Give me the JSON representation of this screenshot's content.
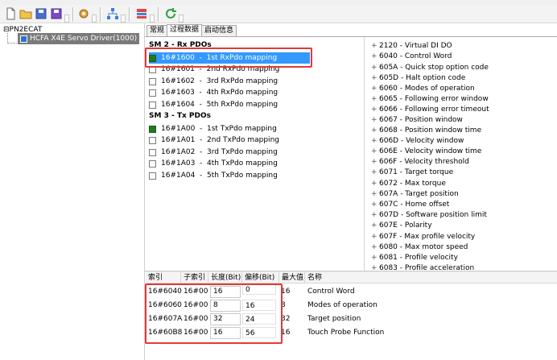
{
  "toolbar": {
    "buttons": [
      "new-file-icon",
      "open-folder-icon",
      "save-icon",
      "save-all-icon",
      "settings-icon",
      "network-icon",
      "device-config-icon",
      "refresh-icon"
    ]
  },
  "tree": {
    "root_label": "PN2ECAT",
    "device_label": "HCFA X4E Servo Driver(1000)"
  },
  "tabs": [
    {
      "label": "常规",
      "active": false
    },
    {
      "label": "过程数据",
      "active": true
    },
    {
      "label": "启动信息",
      "active": false
    }
  ],
  "sm2": {
    "title": "SM 2 - Rx PDOs",
    "items": [
      {
        "text": "16#1600  -  1st RxPdo mapping",
        "checked": true,
        "selected": true
      },
      {
        "text": "16#1601  -  2nd RxPdo mapping",
        "checked": false,
        "selected": false
      },
      {
        "text": "16#1602  -  3rd RxPdo mapping",
        "checked": false,
        "selected": false
      },
      {
        "text": "16#1603  -  4th RxPdo mapping",
        "checked": false,
        "selected": false
      },
      {
        "text": "16#1604  -  5th RxPdo mapping",
        "checked": false,
        "selected": false
      }
    ]
  },
  "sm3": {
    "title": "SM 3 - Tx PDOs",
    "items": [
      {
        "text": "16#1A00  -  1st TxPdo mapping",
        "checked": true
      },
      {
        "text": "16#1A01  -  2nd TxPdo mapping",
        "checked": false
      },
      {
        "text": "16#1A02  -  3rd TxPdo mapping",
        "checked": false
      },
      {
        "text": "16#1A03  -  4th TxPdo mapping",
        "checked": false
      },
      {
        "text": "16#1A04  -  5th TxPdo mapping",
        "checked": false
      }
    ]
  },
  "objects": [
    "2120 - Virtual DI DO",
    "6040 - Control Word",
    "605A - Quick stop option code",
    "605D - Halt option code",
    "6060 - Modes of operation",
    "6065 - Following error window",
    "6066 - Following error timeout",
    "6067 - Position window",
    "6068 - Position window time",
    "606D - Velocity window",
    "606E - Velocity window time",
    "606F - Velocity threshold",
    "6071 - Target torque",
    "6072 - Max torque",
    "607A - Target position",
    "607C - Home offset",
    "607D - Software position limit",
    "607E - Polarity",
    "607F - Max profile velocity",
    "6080 - Max motor speed",
    "6081 - Profile velocity",
    "6083 - Profile acceleration"
  ],
  "grid": {
    "headers": [
      "索引",
      "子索引",
      "长度(Bit)",
      "偏移(Bit)",
      "最大值",
      "名称"
    ],
    "rows": [
      {
        "index": "16#6040",
        "sub": "16#00",
        "len": "16",
        "offset": "0",
        "max": "16",
        "name": "Control Word"
      },
      {
        "index": "16#6060",
        "sub": "16#00",
        "len": "8",
        "offset": "16",
        "max": "8",
        "name": "Modes of operation"
      },
      {
        "index": "16#607A",
        "sub": "16#00",
        "len": "32",
        "offset": "24",
        "max": "32",
        "name": "Target position"
      },
      {
        "index": "16#60B8",
        "sub": "16#00",
        "len": "16",
        "offset": "56",
        "max": "16",
        "name": "Touch Probe Function"
      }
    ]
  },
  "colors": {
    "selection": "#3399ff",
    "checked": "#1f7a1f",
    "highlight": "#e53935"
  }
}
